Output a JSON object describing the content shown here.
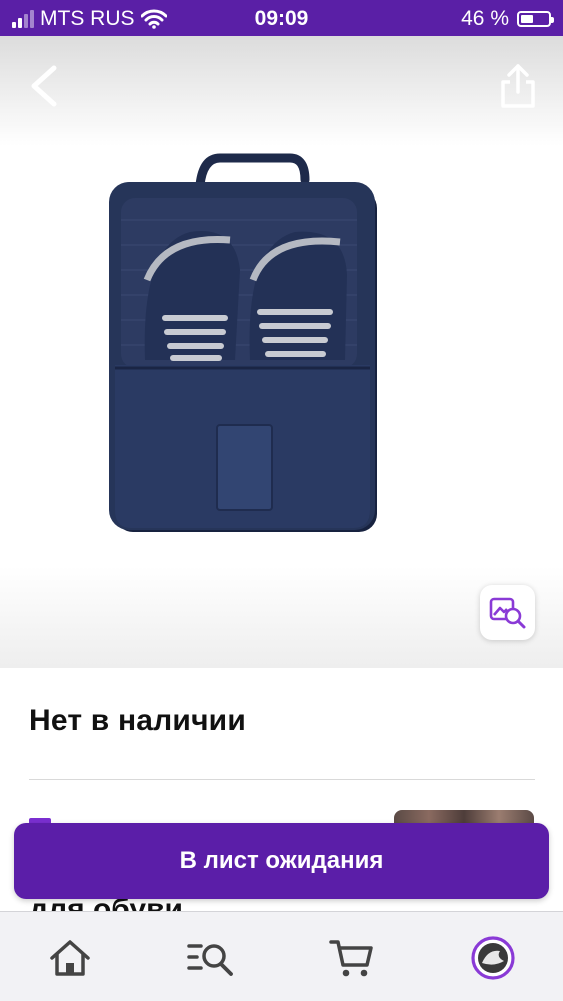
{
  "status_bar": {
    "carrier": "MTS RUS",
    "time": "09:09",
    "battery": "46 %",
    "battery_level": 0.46
  },
  "hero": {
    "icons": [
      "back-chevron-icon",
      "share-icon",
      "image-search-icon"
    ]
  },
  "product": {
    "availability": "Нет в наличии",
    "title_partial": "для обуви"
  },
  "cta": {
    "label": "В лист ожидания"
  },
  "tabbar": {
    "items": [
      "home-icon",
      "catalog-search-icon",
      "cart-icon",
      "profile-avatar-icon"
    ],
    "accent": "#5b1ea8"
  }
}
